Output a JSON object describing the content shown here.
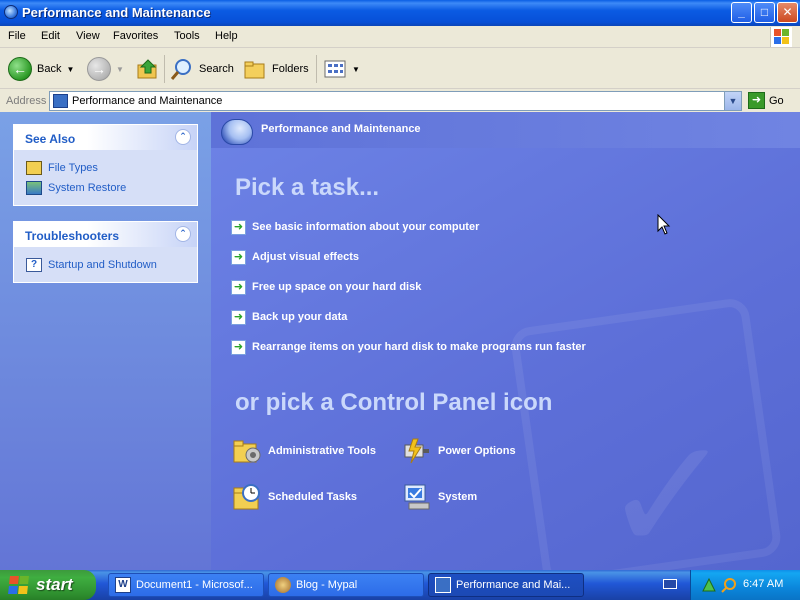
{
  "window": {
    "title": "Performance and Maintenance",
    "buttons": {
      "minimize": "_",
      "maximize": "□",
      "close": "✕"
    }
  },
  "menu": [
    "File",
    "Edit",
    "View",
    "Favorites",
    "Tools",
    "Help"
  ],
  "toolbar": {
    "back_label": "Back",
    "search_label": "Search",
    "folders_label": "Folders"
  },
  "address": {
    "label": "Address",
    "value": "Performance and Maintenance",
    "go_label": "Go"
  },
  "sidebar": {
    "see_also": {
      "title": "See Also",
      "items": [
        {
          "label": "File Types",
          "icon": "file-types-icon"
        },
        {
          "label": "System Restore",
          "icon": "system-restore-icon"
        }
      ]
    },
    "troubleshooters": {
      "title": "Troubleshooters",
      "items": [
        {
          "label": "Startup and Shutdown",
          "icon": "help-icon"
        }
      ]
    }
  },
  "main": {
    "header_title": "Performance and Maintenance",
    "pick_task_heading": "Pick a task...",
    "tasks": [
      "See basic information about your computer",
      "Adjust visual effects",
      "Free up space on your hard disk",
      "Back up your data",
      "Rearrange items on your hard disk to make programs run faster"
    ],
    "pick_icon_heading": "or pick a Control Panel icon",
    "control_panel_icons": [
      {
        "label": "Administrative Tools",
        "icon": "administrative-tools-icon"
      },
      {
        "label": "Power Options",
        "icon": "power-options-icon"
      },
      {
        "label": "Scheduled Tasks",
        "icon": "scheduled-tasks-icon"
      },
      {
        "label": "System",
        "icon": "system-icon"
      }
    ]
  },
  "taskbar": {
    "start_label": "start",
    "tasks": [
      {
        "label": "Document1 - Microsof...",
        "icon": "word-icon",
        "active": false
      },
      {
        "label": "Blog - Mypal",
        "icon": "browser-icon",
        "active": false
      },
      {
        "label": "Performance and Mai...",
        "icon": "folder-window-icon",
        "active": true
      }
    ],
    "clock": "6:47 AM"
  },
  "colors": {
    "title_blue": "#0b5be3",
    "sidebar_blue": "#7aa1e6",
    "main_blue": "#6375d6",
    "link_blue": "#215dc6",
    "start_green": "#3fae40"
  }
}
